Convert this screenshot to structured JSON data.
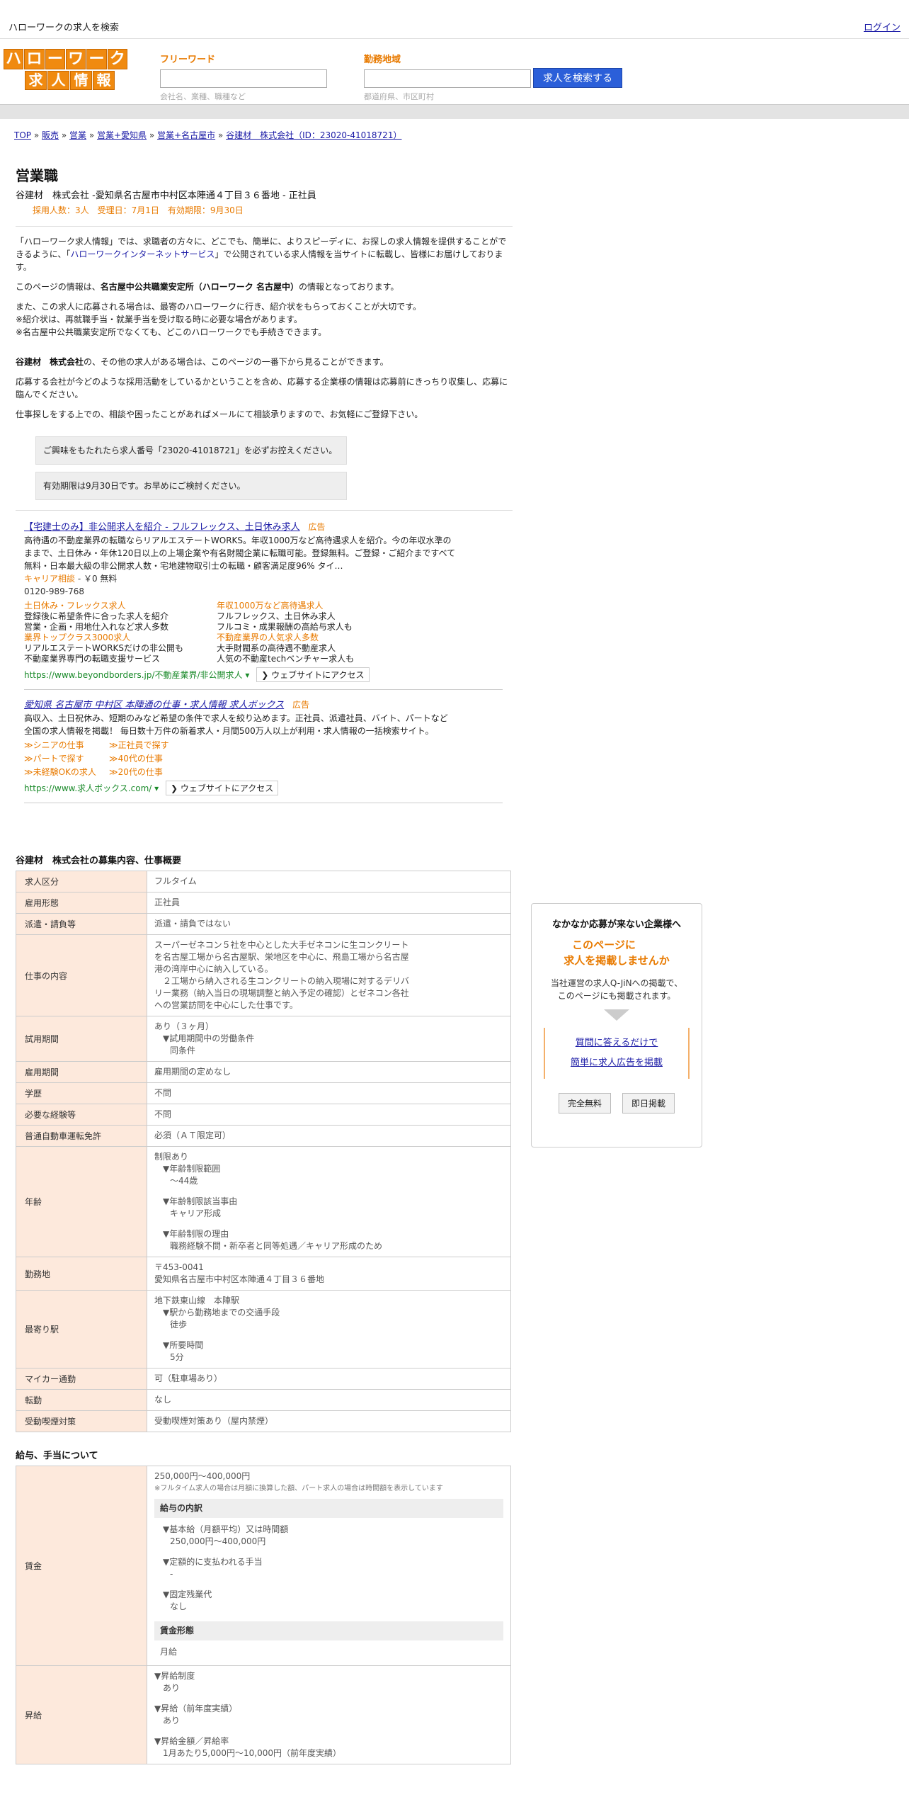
{
  "topbar": {
    "site_title": "ハローワークの求人を検索",
    "login": "ログイン"
  },
  "logo": {
    "row1": [
      "ハ",
      "ロ",
      "ー",
      "ワ",
      "ー",
      "ク"
    ],
    "row2": [
      "求",
      "人",
      "情",
      "報"
    ]
  },
  "search": {
    "keyword_label": "フリーワード",
    "keyword_hint": "会社名、業種、職種など",
    "area_label": "勤務地域",
    "area_hint": "都道府県、市区町村",
    "button": "求人を検索する"
  },
  "breadcrumb": [
    {
      "text": "TOP"
    },
    {
      "text": "販売"
    },
    {
      "text": "営業"
    },
    {
      "text": "営業+愛知県"
    },
    {
      "text": "営業+名古屋市"
    },
    {
      "text": "谷建材　株式会社（ID：23020-41018721）"
    }
  ],
  "job": {
    "title": "営業職",
    "company_line": "谷建材　株式会社 -愛知県名古屋市中村区本陣通４丁目３６番地 - 正社員",
    "meta": "採用人数：3人　受理日：7月1日　有効期限：9月30日"
  },
  "intro": {
    "p1a": "「ハローワーク求人情報」では、求職者の方々に、どこでも、簡単に、よりスピーディに、お探しの求人情報を提供することができるように、「",
    "p1link": "ハローワークインターネットサービス",
    "p1b": "」で公開されている求人情報を当サイトに転載し、皆様にお届けしております。",
    "p2a": "このページの情報は、",
    "p2b": "名古屋中公共職業安定所（ハローワーク 名古屋中）",
    "p2c": "の情報となっております。",
    "p3l1": "また、この求人に応募される場合は、最寄のハローワークに行き、紹介状をもらっておくことが大切です。",
    "p3l2": "※紹介状は、再就職手当・就業手当を受け取る時に必要な場合があります。",
    "p3l3": "※名古屋中公共職業安定所でなくても、どこのハローワークでも手続きできます。",
    "p4a": "谷建材　株式会社",
    "p4b": "の、その他の求人がある場合は、このページの一番下から見ることができます。",
    "p5": "応募する会社が今どのような採用活動をしているかということを含め、応募する企業様の情報は応募前にきっちり収集し、応募に臨んでください。",
    "p6": "仕事探しをする上での、相談や困ったことがあればメールにて相談承りますので、お気軽にご登録下さい。",
    "box1": "ご興味をもたれたら求人番号「23020-41018721」を必ずお控えください。",
    "box2": "有効期限は9月30日です。お早めにご検討ください。"
  },
  "ads": [
    {
      "title": "【宅建士のみ】非公開求人を紹介 - フルフレックス、土日休み求人",
      "tag": "広告",
      "desc": "高待遇の不動産業界の転職ならリアルエステートWORKS。年収1000万など高待遇求人を紹介。今の年収水準のままで、土日休み・年休120日以上の上場企業や有名財閥企業に転職可能。登録無料。ご登録・ご紹介まですべて無料・日本最大級の非公開求人数・宅地建物取引士の転職・顧客満足度96%  タイ…",
      "extra1": "キャリア相談",
      "extra2": " - ￥0 無料",
      "phone": "0120-989-768",
      "sitelinks": [
        {
          "t": "土日休み・フレックス求人",
          "d1": "登録後に希望条件に合った求人を紹介",
          "d2": "営業・企画・用地仕入れなど求人多数"
        },
        {
          "t": "年収1000万など高待遇求人",
          "d1": "フルフレックス、土日休み求人",
          "d2": "フルコミ・成果報酬の高給与求人も"
        },
        {
          "t": "業界トップクラス3000求人",
          "d1": "リアルエステートWORKSだけの非公開も",
          "d2": "不動産業界専門の転職支援サービス"
        },
        {
          "t": "不動産業界の人気求人多数",
          "d1": "大手財閥系の高待遇不動産求人",
          "d2": "人気の不動産techベンチャー求人も"
        }
      ],
      "url": "https://www.beyondborders.jp/不動産業界/非公開求人",
      "visit": "❯ ウェブサイトにアクセス"
    },
    {
      "title": "愛知県 名古屋市 中村区 本陣通の仕事・求人情報 求人ボックス",
      "tag": "広告",
      "desc": "高収入、土日祝休み、短期のみなど希望の条件で求人を絞り込めます。正社員、派遣社員、バイト、パートなど全国の求人情報を掲載！ 毎日数十万件の新着求人・月間500万人以上が利用・求人情報の一括検索サイト。",
      "links": [
        [
          "≫シニアの仕事",
          "≫正社員で探す"
        ],
        [
          "≫パートで探す",
          "≫40代の仕事"
        ],
        [
          "≫未経験OKの求人",
          "≫20代の仕事"
        ]
      ],
      "url": "https://www.求人ボックス.com/",
      "visit": "❯ ウェブサイトにアクセス"
    }
  ],
  "overview": {
    "heading": "谷建材　株式会社の募集内容、仕事概要",
    "rows": {
      "r1": {
        "h": "求人区分",
        "v": "フルタイム"
      },
      "r2": {
        "h": "雇用形態",
        "v": "正社員"
      },
      "r3": {
        "h": "派遣・請負等",
        "v": "派遣・請負ではない"
      },
      "r4": {
        "h": "仕事の内容",
        "l1": "スーパーゼネコン５社を中心とした大手ゼネコンに生コンクリート",
        "l2": "を名古屋工場から名古屋駅、栄地区を中心に、飛島工場から名古屋",
        "l3": "港の湾岸中心に納入している。",
        "l4": "　２工場から納入される生コンクリートの納入現場に対するデリバ",
        "l5": "リー業務（納入当日の現場調整と納入予定の確認）とゼネコン各社",
        "l6": "への営業訪問を中心にした仕事です。"
      },
      "r5": {
        "h": "試用期間",
        "l1": "あり（３ヶ月）",
        "l2": "▼試用期間中の労働条件",
        "l3": "同条件"
      },
      "r6": {
        "h": "雇用期間",
        "v": "雇用期間の定めなし"
      },
      "r7": {
        "h": "学歴",
        "v": "不問"
      },
      "r8": {
        "h": "必要な経験等",
        "v": "不問"
      },
      "r9": {
        "h": "普通自動車運転免許",
        "v": "必須（ＡＴ限定可）"
      },
      "r10": {
        "h": "年齢",
        "l1": "制限あり",
        "l2": "▼年齢制限範囲",
        "l3": "〜44歳",
        "l4": "▼年齢制限該当事由",
        "l5": "キャリア形成",
        "l6": "▼年齢制限の理由",
        "l7": "職務経験不問・新卒者と同等処遇／キャリア形成のため"
      },
      "r11": {
        "h": "勤務地",
        "l1": "〒453-0041",
        "l2": "愛知県名古屋市中村区本陣通４丁目３６番地"
      },
      "r12": {
        "h": "最寄り駅",
        "l1": "地下鉄東山線　本陣駅",
        "l2": "▼駅から勤務地までの交通手段",
        "l3": "徒歩",
        "l4": "▼所要時間",
        "l5": "5分"
      },
      "r13": {
        "h": "マイカー通勤",
        "v": "可（駐車場あり）"
      },
      "r14": {
        "h": "転勤",
        "v": "なし"
      },
      "r15": {
        "h": "受動喫煙対策",
        "v": "受動喫煙対策あり（屋内禁煙）"
      }
    }
  },
  "salary": {
    "heading": "給与、手当について",
    "wage": {
      "h": "賃金",
      "range": "250,000円〜400,000円",
      "note": "※フルタイム求人の場合は月額に換算した額、パート求人の場合は時間額を表示しています",
      "breakdown": "給与の内訳",
      "b1": "▼基本給（月額平均）又は時間額",
      "b1v": "250,000円〜400,000円",
      "b2": "▼定額的に支払われる手当",
      "b2v": "-",
      "b3": "▼固定残業代",
      "b3v": "なし",
      "form": "賃金形態",
      "formv": "月給"
    },
    "raise": {
      "h": "昇給",
      "a1": "▼昇給制度",
      "a1v": "あり",
      "a2": "▼昇給（前年度実績）",
      "a2v": "あり",
      "a3": "▼昇給金額／昇給率",
      "a3v": "1月あたり5,000円〜10,000円（前年度実績）"
    }
  },
  "sidebar": {
    "title": "なかなか応募が来ない企業様へ",
    "lead1": "このページに",
    "lead2": "求人を掲載しませんか",
    "body1": "当社運営の求人Q-JiNへの掲載で、",
    "body2": "このページにも掲載されます。",
    "link1": "質問に答えるだけで",
    "link2": "簡単に求人広告を掲載",
    "btn1": "完全無料",
    "btn2": "即日掲載"
  }
}
